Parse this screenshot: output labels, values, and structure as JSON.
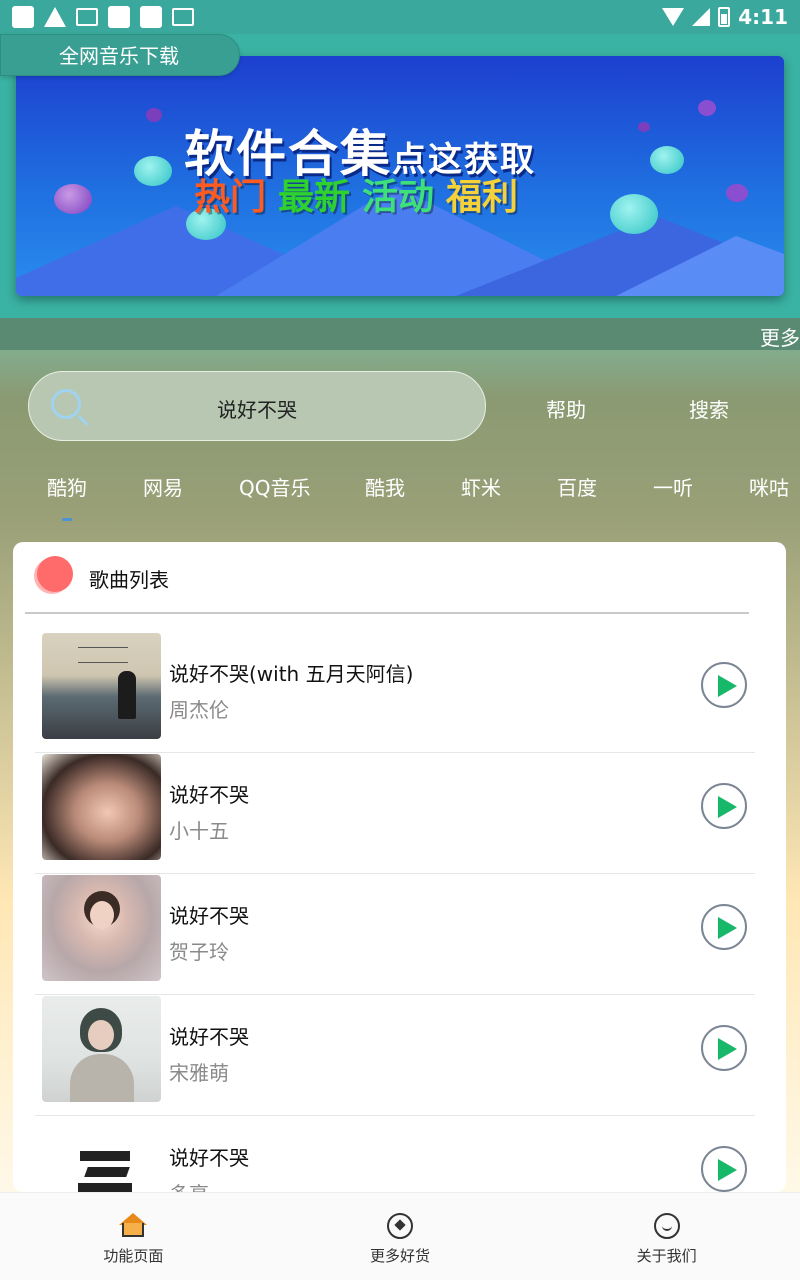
{
  "status_bar": {
    "time": "4:11"
  },
  "app": {
    "title": "全网音乐下载"
  },
  "banner": {
    "title_main": "软件合集",
    "title_small": "点这获取",
    "subtitle_words": [
      "热门",
      "最新",
      "活动",
      "福利"
    ],
    "subtitle_colors": [
      "#ff5a1f",
      "#2ed12e",
      "#3ee07a",
      "#f5d23a"
    ]
  },
  "marquee": {
    "text": "更多"
  },
  "search": {
    "value": "说好不哭",
    "help_label": "帮助",
    "search_label": "搜索"
  },
  "platform_tabs": [
    "酷狗",
    "网易",
    "QQ音乐",
    "酷我",
    "虾米",
    "百度",
    "一听",
    "咪咕"
  ],
  "song_list": {
    "title": "歌曲列表",
    "songs": [
      {
        "title": "说好不哭(with 五月天阿信)",
        "artist": "周杰伦"
      },
      {
        "title": "说好不哭",
        "artist": "小十五"
      },
      {
        "title": "说好不哭",
        "artist": "贺子玲"
      },
      {
        "title": "说好不哭",
        "artist": "宋雅萌"
      },
      {
        "title": "说好不哭",
        "artist": "多亮"
      }
    ]
  },
  "bottom_nav": [
    {
      "label": "功能页面",
      "icon": "home-icon"
    },
    {
      "label": "更多好货",
      "icon": "compass-icon"
    },
    {
      "label": "关于我们",
      "icon": "smile-icon"
    }
  ],
  "colors": {
    "accent_green": "#17b86a",
    "status_bar": "#3aa89c",
    "tab_indicator": "#4b92d8"
  }
}
